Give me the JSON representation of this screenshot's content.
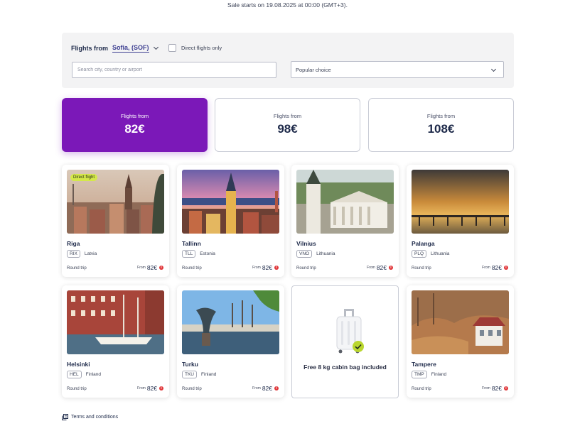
{
  "banner": {
    "sale_note": "Sale starts on 19.08.2025 at 00:00 (GMT+3)."
  },
  "filters": {
    "flights_from_label": "Flights from",
    "origin": "Sofia, (SOF)",
    "direct_only_label": "Direct flights only",
    "direct_only_checked": false,
    "search_placeholder": "Search city, country or airport",
    "sort_selected": "Popular choice"
  },
  "price_tiers": [
    {
      "label": "Flights from",
      "price": "82€",
      "active": true
    },
    {
      "label": "Flights from",
      "price": "98€",
      "active": false
    },
    {
      "label": "Flights from",
      "price": "108€",
      "active": false
    }
  ],
  "destinations": [
    {
      "city": "Riga",
      "code": "RIX",
      "country": "Latvia",
      "trip": "Round trip",
      "from": "From",
      "price": "82€",
      "badge": "Direct flight"
    },
    {
      "city": "Tallinn",
      "code": "TLL",
      "country": "Estonia",
      "trip": "Round trip",
      "from": "From",
      "price": "82€"
    },
    {
      "city": "Vilnius",
      "code": "VNO",
      "country": "Lithuania",
      "trip": "Round trip",
      "from": "From",
      "price": "82€"
    },
    {
      "city": "Palanga",
      "code": "PLQ",
      "country": "Lithuania",
      "trip": "Round trip",
      "from": "From",
      "price": "82€"
    },
    {
      "city": "Helsinki",
      "code": "HEL",
      "country": "Finland",
      "trip": "Round trip",
      "from": "From",
      "price": "82€"
    },
    {
      "city": "Turku",
      "code": "TKU",
      "country": "Finland",
      "trip": "Round trip",
      "from": "From",
      "price": "82€"
    },
    {
      "city": "Tampere",
      "code": "TMP",
      "country": "Finland",
      "trip": "Round trip",
      "from": "From",
      "price": "82€"
    }
  ],
  "promo": {
    "text": "Free 8 kg cabin bag included"
  },
  "footer": {
    "terms": "Terms and conditions"
  },
  "colors": {
    "accent": "#7b18b8",
    "badge": "#d4e84a",
    "check": "#b9d62e",
    "info_dot": "#e03538",
    "navy": "#1e2a4a"
  },
  "icons": {
    "origin_dropdown": "chevron-down-icon",
    "sort_dropdown": "chevron-down-icon",
    "price_info": "info-icon",
    "terms": "document-icon",
    "bag_check": "check-circle-icon"
  }
}
